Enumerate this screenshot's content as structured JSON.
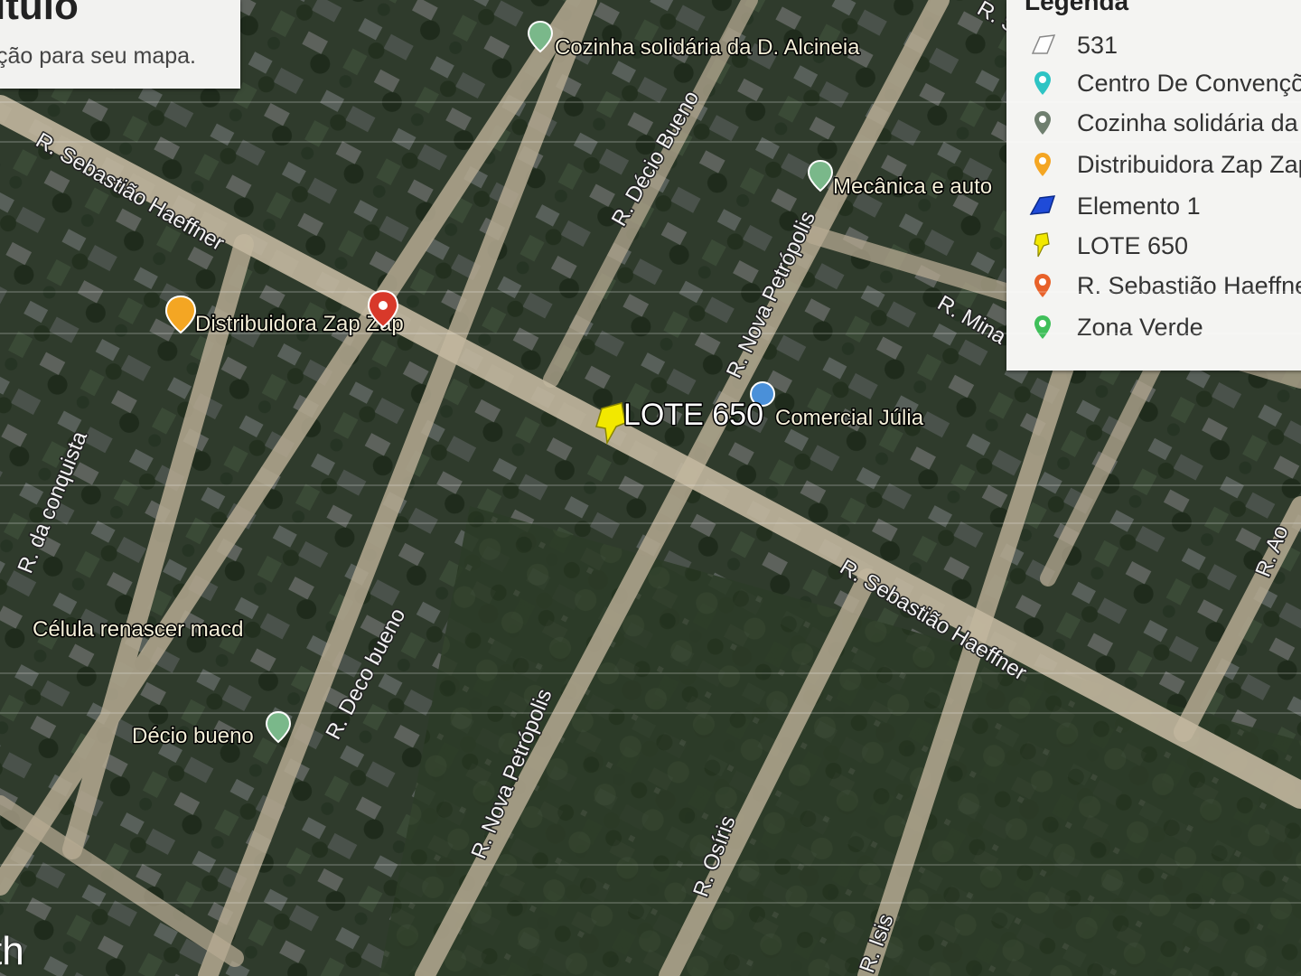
{
  "map_title": {
    "title": "ítulo",
    "description": "ção para seu mapa."
  },
  "legend": {
    "title": "Legenda",
    "items": [
      {
        "label": "531",
        "icon": "polygon-outline-icon",
        "color": "#ffffff"
      },
      {
        "label": "Centro De Convençõ",
        "icon": "pin-icon",
        "color": "#2ec4c4"
      },
      {
        "label": "Cozinha solidária da",
        "icon": "pin-icon",
        "color": "#6f7f6f"
      },
      {
        "label": "Distribuidora Zap Zap",
        "icon": "pin-icon",
        "color": "#f4a623"
      },
      {
        "label": "Elemento 1",
        "icon": "polygon-filled-icon",
        "color": "#1f4bd8"
      },
      {
        "label": "LOTE 650",
        "icon": "pushpin-icon",
        "color": "#f2e800"
      },
      {
        "label": "R. Sebastião Haeffne",
        "icon": "pin-icon",
        "color": "#e8622a"
      },
      {
        "label": "Zona Verde",
        "icon": "pin-icon",
        "color": "#3fbf5a"
      }
    ]
  },
  "map": {
    "lote_label": "LOTE 650",
    "streets": {
      "sebastiao_1": "R. Sebastião Haeffner",
      "sebastiao_2": "R. Sebastião Haeffner",
      "decio_bueno_1": "R. Décio Bueno",
      "decio_bueno_2": "R. Deco bueno",
      "nova_petropolis_1": "R. Nova Petrópolis",
      "nova_petropolis_2": "R. Nova Petrópolis",
      "da_conquista": "R. da conquista",
      "osiris": "R. Osíris",
      "isis": "R. Isis",
      "mina": "R. Mina",
      "top_right": "R. S",
      "right_edge": "R. Ao"
    },
    "pois": {
      "cozinha": "Cozinha solidária da D. Alcineia",
      "mecanica": "Mecânica e auto",
      "distribuidora": "Distribuidora Zap Zap",
      "comercial": "Comercial Júlia",
      "celula": "Célula renascer  macd",
      "decio": "Décio bueno"
    },
    "watermark": "th"
  },
  "colors": {
    "vegetation": "#2e3a2a",
    "road": "#b8ad95",
    "pin_yellow": "#f2e800",
    "pin_orange": "#f4a623",
    "pin_red": "#d8392a",
    "poi_green": "#7ab88a",
    "poi_blue": "#4a90d9"
  }
}
